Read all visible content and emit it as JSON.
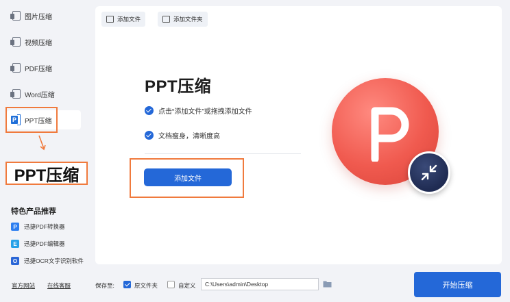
{
  "sidebar": {
    "items": [
      {
        "label": "图片压缩",
        "icon": "image-compress-icon"
      },
      {
        "label": "视频压缩",
        "icon": "video-compress-icon"
      },
      {
        "label": "PDF压缩",
        "icon": "pdf-compress-icon"
      },
      {
        "label": "Word压缩",
        "icon": "word-compress-icon"
      },
      {
        "label": "PPT压缩",
        "icon": "ppt-compress-icon",
        "active": true
      }
    ],
    "callout_label": "PPT压缩",
    "recommend_title": "特色产品推荐",
    "recommend": [
      {
        "label": "迅捷PDF转换器",
        "icon_color": "#2d7ef0",
        "icon_letter": "P"
      },
      {
        "label": "迅捷PDF编辑器",
        "icon_color": "#27a1e8",
        "icon_letter": "E"
      },
      {
        "label": "迅捷OCR文字识别软件",
        "icon_color": "#2a66d6",
        "icon_letter": "O"
      }
    ],
    "footer_links": [
      "官方网站",
      "在线客服"
    ]
  },
  "toolbar": {
    "add_file": "添加文件",
    "add_folder": "添加文件夹"
  },
  "main": {
    "title": "PPT压缩",
    "features": [
      "点击“添加文件”或拖拽添加文件",
      "文档瘦身，清晰度高"
    ],
    "add_button": "添加文件"
  },
  "bottom": {
    "save_to_label": "保存至:",
    "option_source": "原文件夹",
    "option_custom": "自定义",
    "source_checked": true,
    "custom_checked": false,
    "path_value": "C:\\Users\\admin\\Desktop",
    "start_button": "开始压缩"
  },
  "colors": {
    "accent": "#2468d8",
    "highlight": "#f07a3d",
    "logo": "#f05a4f"
  }
}
